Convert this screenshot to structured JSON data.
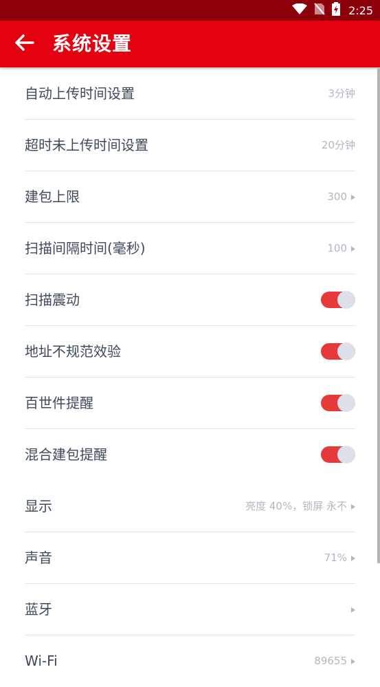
{
  "status_bar": {
    "time": "2:25"
  },
  "app_bar": {
    "title": "系统设置"
  },
  "settings": [
    {
      "label": "自动上传时间设置",
      "value": "3分钟",
      "type": "value",
      "arrow": false,
      "divider": true
    },
    {
      "label": "超时未上传时间设置",
      "value": "20分钟",
      "type": "value",
      "arrow": false,
      "divider": true
    },
    {
      "label": "建包上限",
      "value": "300",
      "type": "value",
      "arrow": true,
      "divider": true
    },
    {
      "label": "扫描间隔时间(毫秒)",
      "value": "100",
      "type": "value",
      "arrow": true,
      "divider": true
    },
    {
      "label": "扫描震动",
      "type": "toggle",
      "on": true,
      "divider": true
    },
    {
      "label": "地址不规范效验",
      "type": "toggle",
      "on": true,
      "divider": true
    },
    {
      "label": "百世件提醒",
      "type": "toggle",
      "on": true,
      "divider": true
    },
    {
      "label": "混合建包提醒",
      "type": "toggle",
      "on": true,
      "divider": false
    },
    {
      "label": "显示",
      "value": "亮度 40%，锁屏 永不",
      "type": "value",
      "arrow": true,
      "divider": true
    },
    {
      "label": "声音",
      "value": "71%",
      "type": "value",
      "arrow": true,
      "divider": true
    },
    {
      "label": "蓝牙",
      "value": "",
      "type": "value",
      "arrow": true,
      "divider": true
    },
    {
      "label": "Wi-Fi",
      "value": "89655",
      "type": "value",
      "arrow": true,
      "divider": false
    }
  ],
  "colors": {
    "status_bar": "#8c0009",
    "app_bar": "#e3000f",
    "toggle_on": "#e63a3a"
  }
}
